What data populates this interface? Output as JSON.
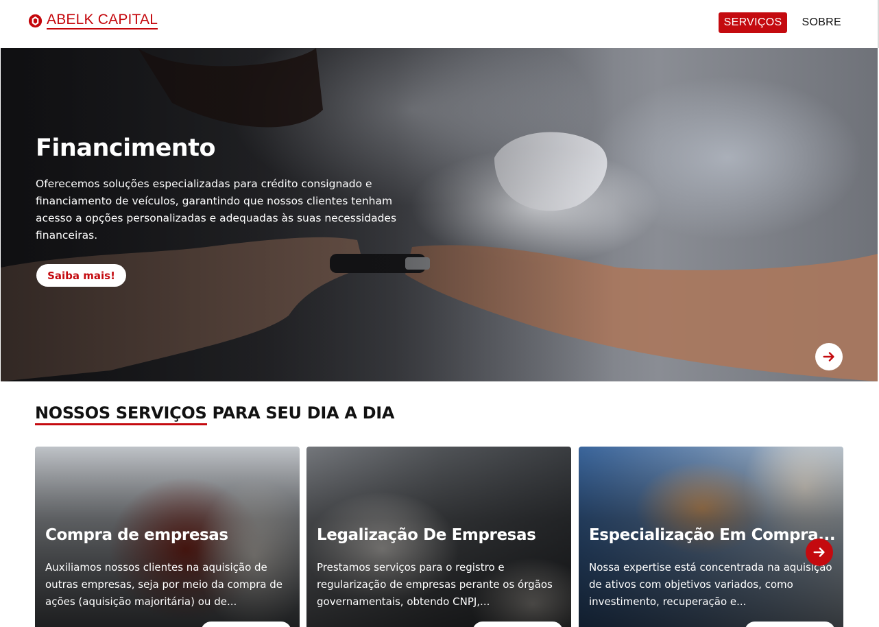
{
  "brand": {
    "name": "ABELK CAPITAL",
    "color": "#c4060b"
  },
  "nav": {
    "items": [
      {
        "label": "SERVIÇOS",
        "active": true
      },
      {
        "label": "SOBRE",
        "active": false
      }
    ]
  },
  "hero": {
    "title": "Financimento",
    "description": "Oferecemos soluções especializadas para crédito consignado e financiamento de veículos, garantindo que nossos clientes tenham acesso a opções personalizadas e adequadas às suas necessidades financeiras.",
    "cta_label": "Saiba mais!",
    "next_icon": "arrow-right-icon"
  },
  "services": {
    "title_highlight": "NOSSOS SERVIÇOS",
    "title_rest": " PARA SEU DIA A DIA",
    "cards": [
      {
        "title": "Compra de empresas",
        "description": "Auxiliamos nossos clientes na aquisição de outras empresas, seja por meio da compra de ações (aquisição majoritária) ou de..."
      },
      {
        "title": "Legalização De Empresas",
        "description": "Prestamos serviços para o registro e regularização de empresas perante os órgãos governamentais, obtendo CNPJ,..."
      },
      {
        "title": "Especialização Em Compra...",
        "description": "Nossa expertise está concentrada na aquisição de ativos com objetivos variados, como investimento, recuperação e..."
      }
    ]
  },
  "colors": {
    "accent": "#c40a0f",
    "text": "#111111",
    "background": "#ffffff"
  }
}
